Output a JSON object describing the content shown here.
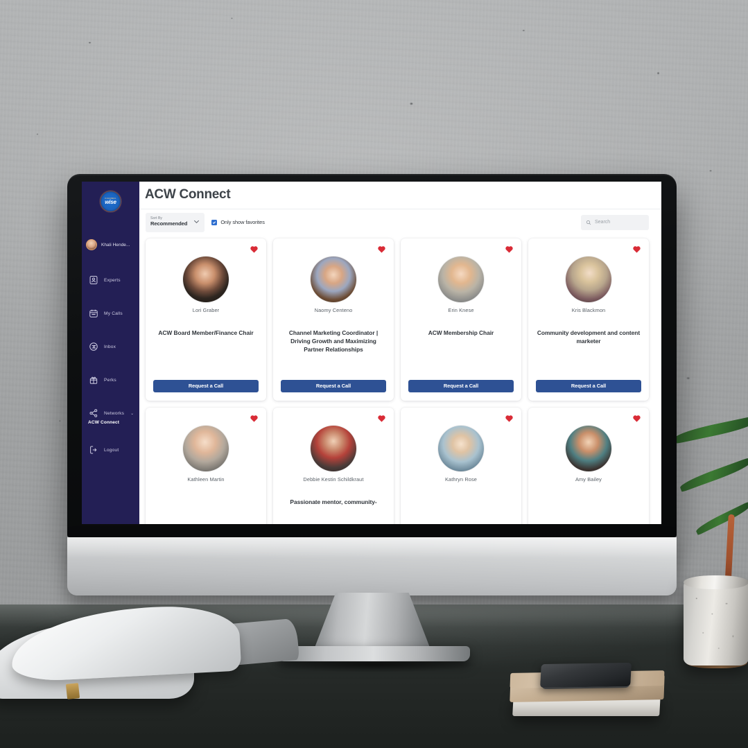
{
  "app": {
    "brand": {
      "line1": "CHANNEL",
      "line2": "wise"
    },
    "page_title": "ACW Connect"
  },
  "sidebar": {
    "user": {
      "name": "Khali Hende...",
      "avatar": "user-avatar"
    },
    "items": [
      {
        "label": "Experts",
        "icon": "experts-icon",
        "active": false
      },
      {
        "label": "My Calls",
        "icon": "calendar-icon",
        "active": false
      },
      {
        "label": "Inbox",
        "icon": "inbox-icon",
        "active": false
      },
      {
        "label": "Perks",
        "icon": "gift-icon",
        "active": false
      },
      {
        "label": "Networks",
        "icon": "network-icon",
        "active": false,
        "chevron": "⌄"
      }
    ],
    "sub_item": {
      "label": "ACW Connect"
    },
    "logout": {
      "label": "Logout",
      "icon": "logout-icon"
    }
  },
  "toolbar": {
    "sort": {
      "label": "Sort By",
      "value": "Recommended",
      "caret": "chevron-down-icon"
    },
    "favorites_filter": {
      "label": "Only show favorites",
      "checked": true
    },
    "search": {
      "placeholder": "Search",
      "value": "",
      "icon": "search-icon"
    }
  },
  "cards": {
    "cta_label": "Request a Call",
    "favorite_icon": "heart-filled-icon",
    "items": [
      {
        "name": "Lori Graber",
        "title": "ACW Board Member/Finance Chair",
        "favorited": true,
        "photo": "p1"
      },
      {
        "name": "Naomy Centeno",
        "title": "Channel Marketing Coordinator | Driving Growth and Maximizing Partner Relationships",
        "favorited": true,
        "photo": "p2"
      },
      {
        "name": "Erin Knese",
        "title": "ACW Membership Chair",
        "favorited": true,
        "photo": "p3"
      },
      {
        "name": "Kris Blackmon",
        "title": "Community development and content marketer",
        "favorited": true,
        "photo": "p4"
      },
      {
        "name": "Kathleen Martin",
        "title": "",
        "favorited": true,
        "photo": "p5"
      },
      {
        "name": "Debbie Kestin Schildkraut",
        "title": "Passionate mentor, community-",
        "favorited": true,
        "photo": "p6"
      },
      {
        "name": "Kathryn Rose",
        "title": "",
        "favorited": true,
        "photo": "p7"
      },
      {
        "name": "Amy Bailey",
        "title": "",
        "favorited": true,
        "photo": "p8"
      }
    ]
  },
  "colors": {
    "sidebar_bg": "#231f55",
    "cta_blue": "#2e5194",
    "heart_red": "#d92b36",
    "checkbox_blue": "#2f6fd0",
    "title_text": "#3d4349"
  }
}
